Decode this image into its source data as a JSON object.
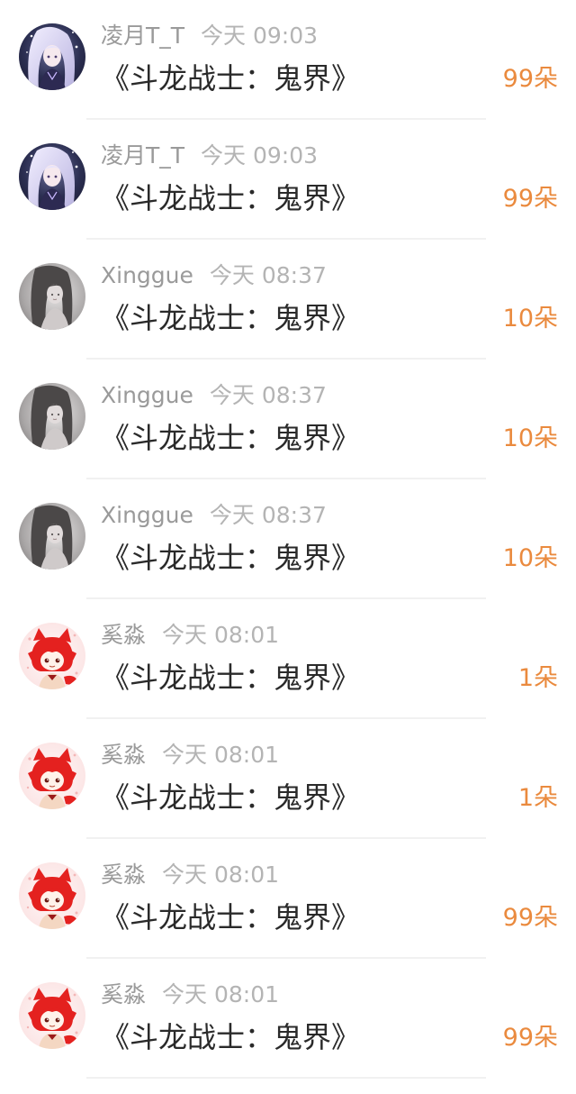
{
  "gifts": [
    {
      "user": "凌月T_T",
      "time": "今天 09:03",
      "title": "《斗龙战士：鬼界》",
      "count": "99朵",
      "avatar_icon": "anime-girl-silver-hair-avatar"
    },
    {
      "user": "凌月T_T",
      "time": "今天 09:03",
      "title": "《斗龙战士：鬼界》",
      "count": "99朵",
      "avatar_icon": "anime-girl-silver-hair-avatar"
    },
    {
      "user": "Xinggue",
      "time": "今天 08:37",
      "title": "《斗龙战士：鬼界》",
      "count": "10朵",
      "avatar_icon": "girl-grey-photo-avatar"
    },
    {
      "user": "Xinggue",
      "time": "今天 08:37",
      "title": "《斗龙战士：鬼界》",
      "count": "10朵",
      "avatar_icon": "girl-grey-photo-avatar"
    },
    {
      "user": "Xinggue",
      "time": "今天 08:37",
      "title": "《斗龙战士：鬼界》",
      "count": "10朵",
      "avatar_icon": "girl-grey-photo-avatar"
    },
    {
      "user": "奚淼",
      "time": "今天 08:01",
      "title": "《斗龙战士：鬼界》",
      "count": "1朵",
      "avatar_icon": "red-fox-character-avatar"
    },
    {
      "user": "奚淼",
      "time": "今天 08:01",
      "title": "《斗龙战士：鬼界》",
      "count": "1朵",
      "avatar_icon": "red-fox-character-avatar"
    },
    {
      "user": "奚淼",
      "time": "今天 08:01",
      "title": "《斗龙战士：鬼界》",
      "count": "99朵",
      "avatar_icon": "red-fox-character-avatar"
    },
    {
      "user": "奚淼",
      "time": "今天 08:01",
      "title": "《斗龙战士：鬼界》",
      "count": "99朵",
      "avatar_icon": "red-fox-character-avatar"
    }
  ],
  "colors": {
    "count_accent": "#ea8a3e",
    "username": "#9a9a9a",
    "time": "#b4b4b4",
    "title": "#2a2a2a"
  }
}
